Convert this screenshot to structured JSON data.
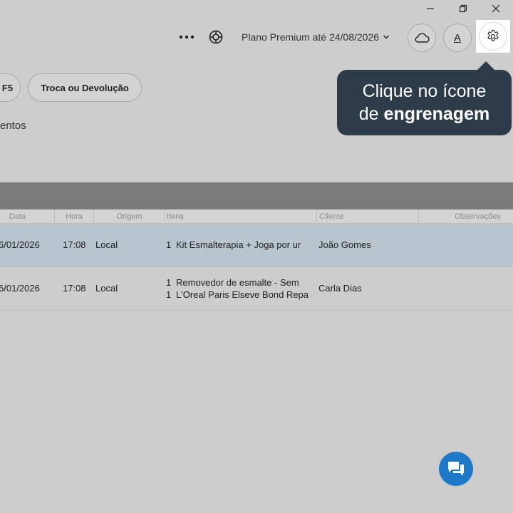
{
  "window": {
    "minimize_icon": "minimize-icon",
    "restore_icon": "restore-icon",
    "close_icon": "close-icon"
  },
  "topbar": {
    "more_icon": "more-dots-icon",
    "support_icon": "lifebuoy-icon",
    "plan_label": "Plano Premium até 24/08/2026",
    "cloud_icon": "cloud-icon",
    "font_button_label": "A",
    "settings_icon": "gear-icon"
  },
  "actions": {
    "partial_button_label": "F5",
    "return_button_label": "Troca ou Devolução"
  },
  "section": {
    "partial_title": "entos"
  },
  "table": {
    "columns": [
      "Data",
      "Hora",
      "Origem",
      "Itens",
      "Cliente",
      "Observações"
    ],
    "rows": [
      {
        "date": "6/01/2026",
        "time": "17:08",
        "origin": "Local",
        "items": [
          {
            "qty": "1",
            "name": "Kit Esmalterapia + Joga por ur"
          }
        ],
        "client": "João Gomes",
        "notes": ""
      },
      {
        "date": "6/01/2026",
        "time": "17:08",
        "origin": "Local",
        "items": [
          {
            "qty": "1",
            "name": "Removedor de esmalte - Sem"
          },
          {
            "qty": "1",
            "name": "L'Oreal Paris Elseve Bond Repa"
          }
        ],
        "client": "Carla Dias",
        "notes": ""
      }
    ]
  },
  "tooltip": {
    "line1": "Clique no ícone",
    "line2_prefix": "de ",
    "line2_bold": "engrenagem"
  },
  "colors": {
    "tooltip_bg": "#2e3b48",
    "selected_row": "#b8c5ce",
    "fab": "#1e78c8",
    "table_band": "#7a7a7a"
  },
  "fab_icon": "chat-icon"
}
